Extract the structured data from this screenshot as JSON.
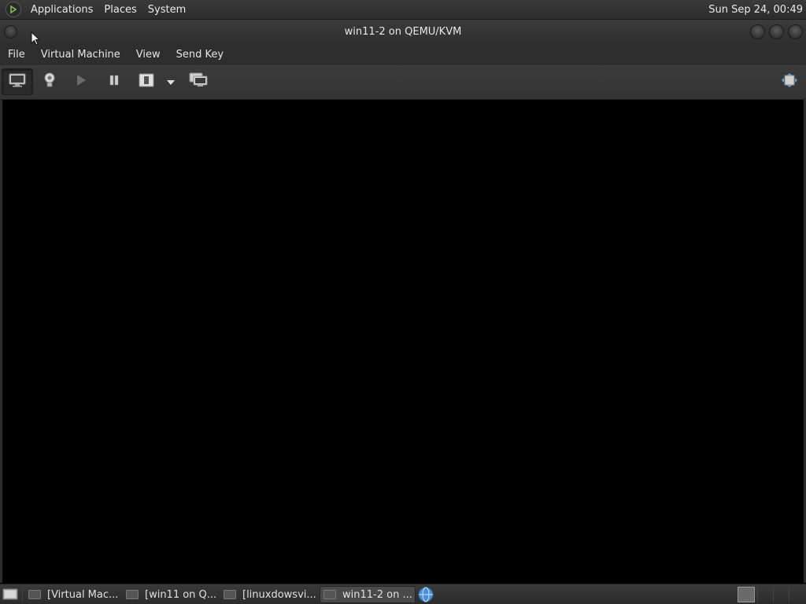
{
  "top_panel": {
    "menu": [
      "Applications",
      "Places",
      "System"
    ],
    "clock": "Sun Sep 24, 00:49"
  },
  "window": {
    "title": "win11-2 on QEMU/KVM"
  },
  "menubar": {
    "items": [
      "File",
      "Virtual Machine",
      "View",
      "Send Key"
    ]
  },
  "toolbar": {
    "buttons": [
      {
        "icon": "console-monitor-icon",
        "active": true
      },
      {
        "icon": "lightbulb-details-icon",
        "active": false
      },
      {
        "icon": "play-run-icon",
        "active": false
      },
      {
        "icon": "pause-icon",
        "active": false
      },
      {
        "icon": "shutdown-power-icon",
        "active": false
      },
      {
        "icon": "dropdown-arrow-icon",
        "active": false
      },
      {
        "icon": "snapshot-manager-icon",
        "active": false
      },
      {
        "icon": "fullscreen-icon",
        "active": false
      }
    ]
  },
  "taskbar": {
    "tasks": [
      {
        "label": "[Virtual Mac...",
        "active": false
      },
      {
        "label": "[win11 on Q...",
        "active": false
      },
      {
        "label": "[linuxdowsvi...",
        "active": false
      },
      {
        "label": "win11-2 on ...",
        "active": true
      }
    ]
  },
  "colors": {
    "panel": "#2e2e2e",
    "display": "#000000",
    "text": "#e6e6e6"
  }
}
